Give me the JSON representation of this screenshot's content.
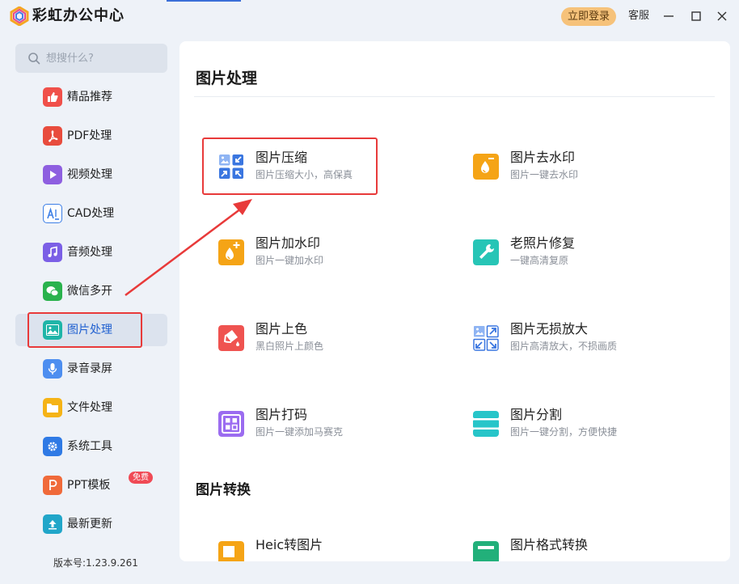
{
  "app": {
    "title": "彩虹办公中心",
    "login_label": "立即登录",
    "service_label": "客服"
  },
  "colors": {
    "accent": "#3b6fd8",
    "login_bg": "#f6c27a",
    "highlight": "#e83a3a",
    "badge": "#f04a55"
  },
  "search": {
    "placeholder": "想搜什么?",
    "value": ""
  },
  "sidebar": {
    "items": [
      {
        "label": "精品推荐",
        "icon": "thumbs-up-icon",
        "color": "#f0504a"
      },
      {
        "label": "PDF处理",
        "icon": "pdf-icon",
        "color": "#e84c3d"
      },
      {
        "label": "视频处理",
        "icon": "play-icon",
        "color": "#8e5fe0"
      },
      {
        "label": "CAD处理",
        "icon": "cad-icon",
        "color": "#3d7fe6"
      },
      {
        "label": "音频处理",
        "icon": "music-icon",
        "color": "#7b5fe6"
      },
      {
        "label": "微信多开",
        "icon": "wechat-icon",
        "color": "#2ab24d"
      },
      {
        "label": "图片处理",
        "icon": "image-icon",
        "color": "#1fb5a8",
        "active": true
      },
      {
        "label": "录音录屏",
        "icon": "microphone-icon",
        "color": "#4d8ef0"
      },
      {
        "label": "文件处理",
        "icon": "folder-icon",
        "color": "#f5b316"
      },
      {
        "label": "系统工具",
        "icon": "gear-icon",
        "color": "#2f7ae5"
      },
      {
        "label": "PPT模板",
        "icon": "ppt-icon",
        "color": "#f06a3a",
        "badge": "免费"
      },
      {
        "label": "最新更新",
        "icon": "upload-icon",
        "color": "#21a6c9"
      }
    ],
    "version": "版本号:1.23.9.261"
  },
  "main": {
    "section1_title": "图片处理",
    "section2_title": "图片转换",
    "tools": [
      {
        "title": "图片压缩",
        "desc": "图片压缩大小，高保真",
        "icon": "compress-icon"
      },
      {
        "title": "图片去水印",
        "desc": "图片一键去水印",
        "icon": "remove-watermark-icon"
      },
      {
        "title": "图片加水印",
        "desc": "图片一键加水印",
        "icon": "add-watermark-icon"
      },
      {
        "title": "老照片修复",
        "desc": "一键高清复原",
        "icon": "repair-icon"
      },
      {
        "title": "图片上色",
        "desc": "黑白照片上颜色",
        "icon": "colorize-icon"
      },
      {
        "title": "图片无损放大",
        "desc": "图片高清放大，不损画质",
        "icon": "enlarge-icon"
      },
      {
        "title": "图片打码",
        "desc": "图片一键添加马赛克",
        "icon": "mosaic-icon"
      },
      {
        "title": "图片分割",
        "desc": "图片一键分割，方便快捷",
        "icon": "split-icon"
      }
    ],
    "conversions": [
      {
        "title": "Heic转图片",
        "icon": "heic-icon"
      },
      {
        "title": "图片格式转换",
        "icon": "format-icon"
      }
    ]
  }
}
